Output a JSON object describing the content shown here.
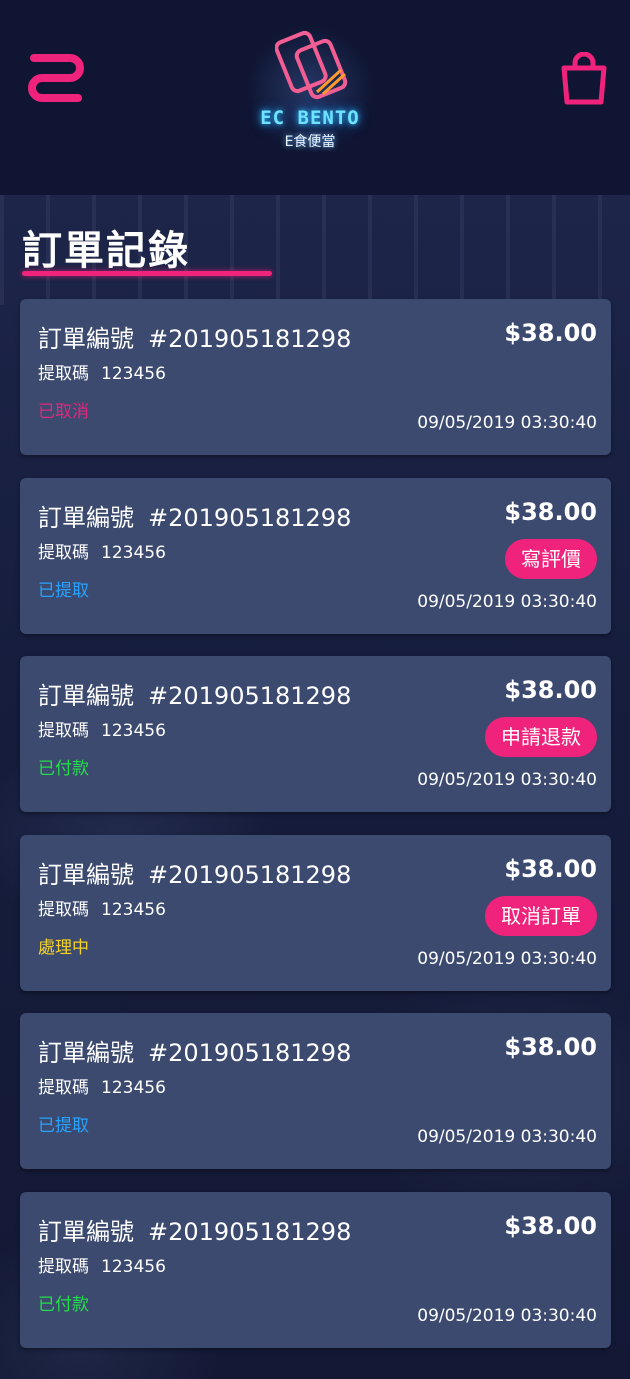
{
  "app": {
    "logo_text": "EC BENTO",
    "logo_sub": "E食便當"
  },
  "page": {
    "title": "訂單記錄"
  },
  "colors": {
    "accent": "#f0237c",
    "card_bg": "#3c4a6f",
    "status_cancelled": "#e0287e",
    "status_picked": "#27a3ff",
    "status_paid": "#22e04a",
    "status_processing": "#f5d321"
  },
  "icons": {
    "menu": "menu-icon",
    "cart": "shopping-bag-icon"
  },
  "orders": [
    {
      "label": "訂單編號",
      "number": "#201905181298",
      "price": "$38.00",
      "code_label": "提取碼",
      "code": "123456",
      "status": "已取消",
      "status_color": "#e0287e",
      "datetime": "09/05/2019 03:30:40",
      "action": ""
    },
    {
      "label": "訂單編號",
      "number": "#201905181298",
      "price": "$38.00",
      "code_label": "提取碼",
      "code": "123456",
      "status": "已提取",
      "status_color": "#27a3ff",
      "datetime": "09/05/2019 03:30:40",
      "action": "寫評價"
    },
    {
      "label": "訂單編號",
      "number": "#201905181298",
      "price": "$38.00",
      "code_label": "提取碼",
      "code": "123456",
      "status": "已付款",
      "status_color": "#22e04a",
      "datetime": "09/05/2019 03:30:40",
      "action": "申請退款"
    },
    {
      "label": "訂單編號",
      "number": "#201905181298",
      "price": "$38.00",
      "code_label": "提取碼",
      "code": "123456",
      "status": "處理中",
      "status_color": "#f5d321",
      "datetime": "09/05/2019 03:30:40",
      "action": "取消訂單"
    },
    {
      "label": "訂單編號",
      "number": "#201905181298",
      "price": "$38.00",
      "code_label": "提取碼",
      "code": "123456",
      "status": "已提取",
      "status_color": "#27a3ff",
      "datetime": "09/05/2019 03:30:40",
      "action": ""
    },
    {
      "label": "訂單編號",
      "number": "#201905181298",
      "price": "$38.00",
      "code_label": "提取碼",
      "code": "123456",
      "status": "已付款",
      "status_color": "#22e04a",
      "datetime": "09/05/2019 03:30:40",
      "action": ""
    }
  ]
}
